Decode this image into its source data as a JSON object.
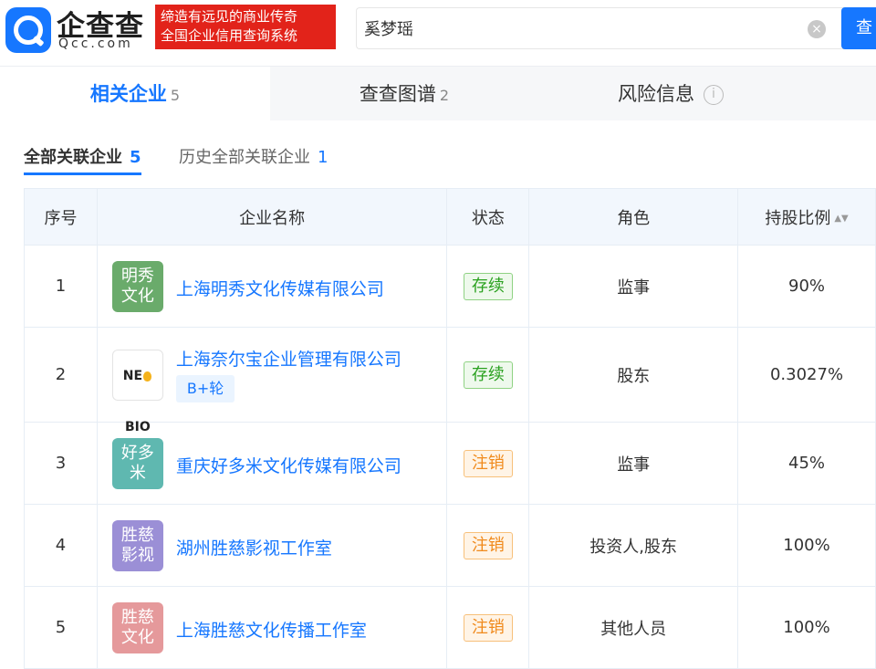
{
  "header": {
    "logo_cn": "企查查",
    "logo_en": "Qcc.com",
    "slogan_line1": "缔造有远见的商业传奇",
    "slogan_line2": "全国企业信用查询系统",
    "search_value": "奚梦瑶",
    "clear_symbol": "×",
    "search_button": "查"
  },
  "tabs": [
    {
      "label": "相关企业",
      "count": "5"
    },
    {
      "label": "查查图谱",
      "count": "2"
    },
    {
      "label": "风险信息",
      "count": ""
    }
  ],
  "info_symbol": "i",
  "subtabs": [
    {
      "label": "全部关联企业",
      "count": "5"
    },
    {
      "label": "历史全部关联企业",
      "count": "1"
    }
  ],
  "table": {
    "headers": {
      "no": "序号",
      "name": "企业名称",
      "status": "状态",
      "role": "角色",
      "share": "持股比例"
    },
    "sort_symbol": "▲▼",
    "rows": [
      {
        "no": "1",
        "avatar": "明秀文化",
        "avatar_color": "#6aab6b",
        "name": "上海明秀文化传媒有限公司",
        "tag": "",
        "status": "存续",
        "role": "监事",
        "share": "90%"
      },
      {
        "no": "2",
        "avatar": "NEOBIO",
        "avatar_color": "#ffffff",
        "name": "上海奈尔宝企业管理有限公司",
        "tag": "B+轮",
        "status": "存续",
        "role": "股东",
        "share": "0.3027%"
      },
      {
        "no": "3",
        "avatar": "好多米",
        "avatar_color": "#5fb8b0",
        "name": "重庆好多米文化传媒有限公司",
        "tag": "",
        "status": "注销",
        "role": "监事",
        "share": "45%"
      },
      {
        "no": "4",
        "avatar": "胜慈影视",
        "avatar_color": "#9b8fd6",
        "name": "湖州胜慈影视工作室",
        "tag": "",
        "status": "注销",
        "role": "投资人,股东",
        "share": "100%"
      },
      {
        "no": "5",
        "avatar": "胜慈文化",
        "avatar_color": "#e5999b",
        "name": "上海胜慈文化传播工作室",
        "tag": "",
        "status": "注销",
        "role": "其他人员",
        "share": "100%"
      }
    ]
  },
  "colors": {
    "accent": "#1677ff",
    "slogan_bg": "#e2231a",
    "status_ok": "#2aa11f",
    "status_bad": "#f08a1c"
  }
}
